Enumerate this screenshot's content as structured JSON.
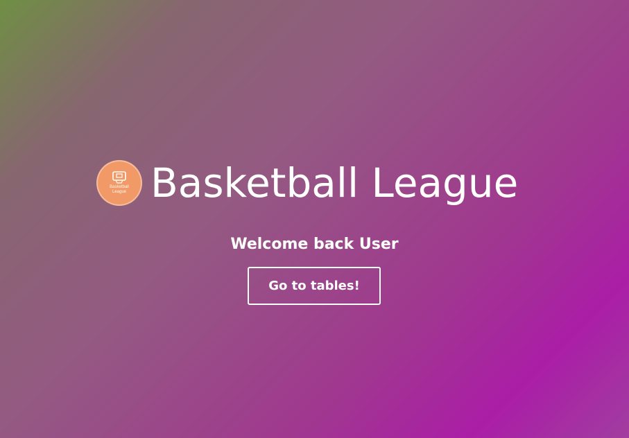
{
  "brand": {
    "logo_lines": [
      "Basketball",
      "League"
    ],
    "logo_icon": "basketball-hoop-icon",
    "title": "Basketball League"
  },
  "hero": {
    "welcome_text": "Welcome back User",
    "cta_label": "Go to tables!"
  },
  "colors": {
    "logo_background": "#f19a67",
    "text": "#ffffff",
    "gradient_start": "#6f8f44",
    "gradient_mid": "#945a82",
    "gradient_end": "#aa1ea6"
  }
}
